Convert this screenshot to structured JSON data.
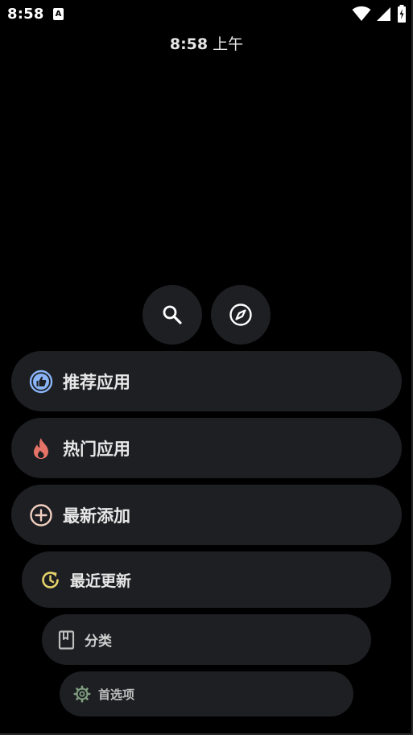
{
  "status_bar": {
    "time": "8:58",
    "notification_icon": "a-icon",
    "icons": [
      "wifi-icon",
      "signal-icon",
      "battery-charging-icon"
    ]
  },
  "clock": {
    "time": "8:58",
    "ampm": "上午"
  },
  "quick_actions": [
    {
      "icon": "search-icon"
    },
    {
      "icon": "compass-icon"
    }
  ],
  "menu": {
    "recommended": {
      "label": "推荐应用",
      "icon": "thumbs-up-icon",
      "color": "#8ab4f8"
    },
    "hot": {
      "label": "热门应用",
      "icon": "fire-icon",
      "color": "#e57368"
    },
    "latest_added": {
      "label": "最新添加",
      "icon": "plus-circle-icon",
      "color": "#f0cfc0"
    },
    "recently_updated": {
      "label": "最近更新",
      "icon": "update-icon",
      "color": "#e6d36a"
    },
    "categories": {
      "label": "分类",
      "icon": "book-icon",
      "color": "#bdbdbd"
    },
    "preferences": {
      "label": "首选项",
      "icon": "gear-icon",
      "color": "#7f9f7f"
    }
  },
  "colors": {
    "background": "#000000",
    "pill": "#1e1f23"
  }
}
